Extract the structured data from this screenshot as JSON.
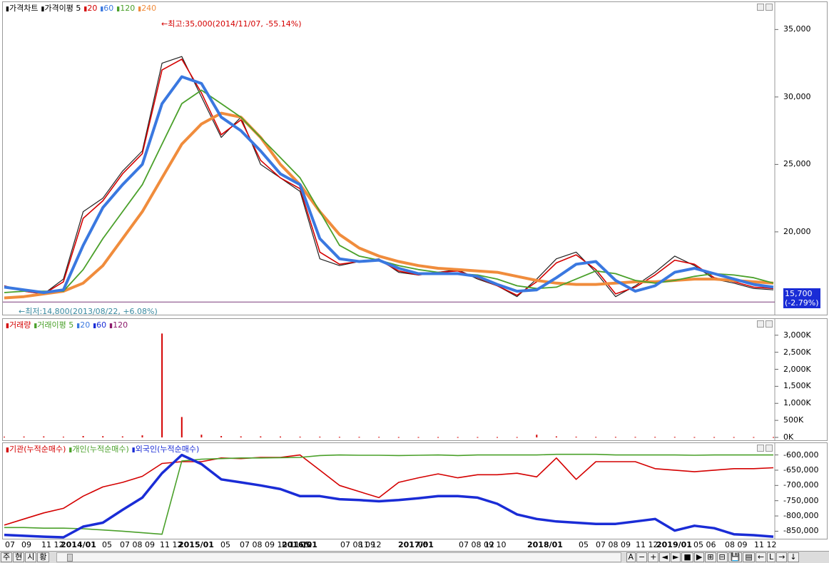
{
  "price_panel": {
    "legend": [
      {
        "text": "가격차트",
        "color": "#000000",
        "marker": "▮"
      },
      {
        "text": "가격이평 5",
        "color": "#000000",
        "marker": "▮"
      },
      {
        "text": "20",
        "color": "#d40000",
        "marker": "▮"
      },
      {
        "text": "60",
        "color": "#3a78e0",
        "marker": "▮"
      },
      {
        "text": "120",
        "color": "#4aa02a",
        "marker": "▮"
      },
      {
        "text": "240",
        "color": "#f08c3c",
        "marker": "▮"
      }
    ],
    "high_label": "←최고:35,000(2014/11/07, -55.14%)",
    "low_label": "←최저:14,800(2013/08/22, +6.08%)",
    "current_price": "15,700",
    "current_change": "(-2.79%)",
    "yticks": [
      "35,000",
      "30,000",
      "25,000",
      "20,000"
    ]
  },
  "volume_panel": {
    "legend": [
      {
        "text": "거래량",
        "color": "#d40000",
        "marker": "▮"
      },
      {
        "text": "거래이평 5",
        "color": "#4aa02a",
        "marker": "▮"
      },
      {
        "text": "20",
        "color": "#3a78e0",
        "marker": "▮"
      },
      {
        "text": "60",
        "color": "#1a2cd6",
        "marker": "▮"
      },
      {
        "text": "120",
        "color": "#8b1a6b",
        "marker": "▮"
      }
    ],
    "yticks": [
      "3,000K",
      "2,500K",
      "2,000K",
      "1,500K",
      "1,000K",
      "500K",
      "0K"
    ]
  },
  "investor_panel": {
    "legend": [
      {
        "text": "기관(누적순매수)",
        "color": "#d40000",
        "marker": "▮"
      },
      {
        "text": "개인(누적순매수)",
        "color": "#4aa02a",
        "marker": "▮"
      },
      {
        "text": "외국인(누적순매수)",
        "color": "#1a2cd6",
        "marker": "▮"
      }
    ],
    "yticks": [
      "-600,000",
      "-650,000",
      "-700,000",
      "-750,000",
      "-800,000",
      "-850,000"
    ]
  },
  "xaxis_labels": [
    {
      "t": "07",
      "bold": false
    },
    {
      "t": "09",
      "bold": false
    },
    {
      "t": "11 12",
      "bold": false
    },
    {
      "t": "2014/01",
      "bold": true
    },
    {
      "t": "05",
      "bold": false
    },
    {
      "t": "07 08 09",
      "bold": false
    },
    {
      "t": "11 12",
      "bold": false
    },
    {
      "t": "2015/01",
      "bold": true
    },
    {
      "t": "05",
      "bold": false
    },
    {
      "t": "07 08 09 10 11 12",
      "bold": false
    },
    {
      "t": "2016/01",
      "bold": true
    },
    {
      "t": "05",
      "bold": false
    },
    {
      "t": "07 08 09",
      "bold": false
    },
    {
      "t": "11 12",
      "bold": false
    },
    {
      "t": "2017/01",
      "bold": true
    },
    {
      "t": "05",
      "bold": false
    },
    {
      "t": "07 08 09 10",
      "bold": false
    },
    {
      "t": "12",
      "bold": false
    },
    {
      "t": "2018/01",
      "bold": true
    },
    {
      "t": "05",
      "bold": false
    },
    {
      "t": "07 08 09",
      "bold": false
    },
    {
      "t": "11 12",
      "bold": false
    },
    {
      "t": "2019/01",
      "bold": true
    },
    {
      "t": "05 06",
      "bold": false
    },
    {
      "t": "08 09",
      "bold": false
    },
    {
      "t": "11 12",
      "bold": false
    }
  ],
  "toolbar": {
    "left_buttons": [
      "주",
      "현",
      "시",
      "황"
    ],
    "right_buttons": [
      "A",
      "−",
      "+",
      "◄",
      "►",
      "■",
      "▶",
      "⊞",
      "⊟",
      "💾",
      "▤",
      "←",
      "L",
      "→",
      "↓"
    ]
  },
  "chart_data": [
    {
      "type": "line",
      "title": "가격차트",
      "x": [
        "2013/07",
        "2013/09",
        "2013/11",
        "2014/01",
        "2014/03",
        "2014/05",
        "2014/07",
        "2014/09",
        "2014/11",
        "2015/01",
        "2015/03",
        "2015/05",
        "2015/07",
        "2015/09",
        "2015/11",
        "2016/01",
        "2016/03",
        "2016/05",
        "2016/07",
        "2016/09",
        "2016/11",
        "2017/01",
        "2017/03",
        "2017/05",
        "2017/07",
        "2017/09",
        "2017/11",
        "2018/01",
        "2018/03",
        "2018/05",
        "2018/07",
        "2018/09",
        "2018/11",
        "2019/01",
        "2019/03",
        "2019/05",
        "2019/07",
        "2019/09",
        "2019/11",
        "2019/12"
      ],
      "ylim": [
        14600,
        36500
      ],
      "series": [
        {
          "name": "5",
          "color": "#000000",
          "values": [
            16000,
            15600,
            15400,
            16500,
            21500,
            22500,
            24500,
            26000,
            32500,
            33000,
            30000,
            27000,
            28500,
            25000,
            24000,
            23000,
            18000,
            17500,
            17800,
            18000,
            17000,
            16800,
            17000,
            17200,
            16500,
            16000,
            15200,
            16500,
            18000,
            18500,
            17000,
            15200,
            16000,
            17000,
            18200,
            17500,
            16500,
            16200,
            15800,
            15700
          ]
        },
        {
          "name": "20",
          "color": "#d40000",
          "values": [
            16000,
            15600,
            15400,
            16300,
            21000,
            22300,
            24300,
            25800,
            32000,
            32800,
            30300,
            27200,
            28300,
            25300,
            24000,
            23200,
            18500,
            17600,
            17800,
            17900,
            17100,
            16800,
            17000,
            17100,
            16600,
            16000,
            15300,
            16300,
            17700,
            18300,
            17200,
            15400,
            15900,
            16800,
            17900,
            17600,
            16600,
            16300,
            15900,
            15800
          ]
        },
        {
          "name": "60",
          "color": "#3a78e0",
          "values": [
            15900,
            15700,
            15500,
            15700,
            19000,
            21800,
            23500,
            25000,
            29500,
            31500,
            31000,
            28500,
            27500,
            26000,
            24300,
            23500,
            19500,
            18000,
            17800,
            17900,
            17300,
            16900,
            16900,
            16900,
            16700,
            16100,
            15600,
            15700,
            16600,
            17600,
            17800,
            16400,
            15600,
            16000,
            17000,
            17300,
            16900,
            16500,
            16100,
            15900
          ]
        },
        {
          "name": "120",
          "color": "#4aa02a",
          "values": [
            15500,
            15600,
            15600,
            15600,
            17200,
            19500,
            21500,
            23500,
            26500,
            29500,
            30500,
            29500,
            28500,
            27000,
            25500,
            24000,
            21500,
            19000,
            18200,
            17900,
            17500,
            17200,
            17000,
            16900,
            16800,
            16500,
            16000,
            15800,
            15900,
            16500,
            17100,
            16900,
            16400,
            16200,
            16400,
            16700,
            16900,
            16800,
            16600,
            16200
          ]
        },
        {
          "name": "240",
          "color": "#f08c3c",
          "values": [
            15100,
            15200,
            15400,
            15600,
            16200,
            17500,
            19500,
            21500,
            24000,
            26500,
            28000,
            28800,
            28500,
            27000,
            25000,
            23500,
            21500,
            19800,
            18800,
            18200,
            17800,
            17500,
            17300,
            17200,
            17100,
            17000,
            16700,
            16400,
            16200,
            16100,
            16100,
            16200,
            16300,
            16300,
            16400,
            16500,
            16500,
            16400,
            16300,
            16200
          ]
        }
      ]
    },
    {
      "type": "bar",
      "title": "거래량",
      "ylim": [
        0,
        3100
      ],
      "series": [
        {
          "name": "거래량",
          "color": "#d40000",
          "values": [
            20,
            25,
            30,
            20,
            40,
            35,
            30,
            60,
            3050,
            600,
            80,
            40,
            30,
            30,
            25,
            20,
            20,
            15,
            15,
            15,
            10,
            10,
            10,
            10,
            10,
            10,
            10,
            80,
            30,
            20,
            15,
            15,
            15,
            15,
            15,
            10,
            10,
            10,
            10,
            10
          ]
        }
      ]
    },
    {
      "type": "line",
      "title": "누적순매수",
      "ylim": [
        -870000,
        -580000
      ],
      "series": [
        {
          "name": "기관(누적순매수)",
          "color": "#d40000",
          "values": [
            -830000,
            -810000,
            -790000,
            -775000,
            -735000,
            -705000,
            -690000,
            -670000,
            -628000,
            -622000,
            -622000,
            -610000,
            -612000,
            -608000,
            -608000,
            -600000,
            -650000,
            -700000,
            -720000,
            -740000,
            -690000,
            -675000,
            -662000,
            -675000,
            -665000,
            -665000,
            -660000,
            -672000,
            -610000,
            -680000,
            -622000,
            -622000,
            -622000,
            -645000,
            -650000,
            -655000,
            -650000,
            -645000,
            -645000,
            -642000
          ]
        },
        {
          "name": "개인(누적순매수)",
          "color": "#4aa02a",
          "values": [
            -838000,
            -838000,
            -840000,
            -840000,
            -842000,
            -846000,
            -850000,
            -855000,
            -860000,
            -620000,
            -614000,
            -612000,
            -610000,
            -610000,
            -609000,
            -608000,
            -602000,
            -600000,
            -601000,
            -601000,
            -602000,
            -601000,
            -600000,
            -602000,
            -600000,
            -600000,
            -600000,
            -600000,
            -598000,
            -598000,
            -598000,
            -600000,
            -600000,
            -600000,
            -600000,
            -601000,
            -600000,
            -600000,
            -600000,
            -600000
          ]
        },
        {
          "name": "외국인(누적순매수)",
          "color": "#1a2cd6",
          "values": [
            -862000,
            -865000,
            -868000,
            -870000,
            -835000,
            -822000,
            -780000,
            -740000,
            -660000,
            -600000,
            -630000,
            -680000,
            -690000,
            -700000,
            -712000,
            -735000,
            -735000,
            -745000,
            -748000,
            -752000,
            -748000,
            -742000,
            -735000,
            -735000,
            -740000,
            -760000,
            -795000,
            -810000,
            -818000,
            -822000,
            -826000,
            -826000,
            -818000,
            -810000,
            -848000,
            -832000,
            -840000,
            -860000,
            -863000,
            -868000
          ]
        }
      ]
    }
  ]
}
